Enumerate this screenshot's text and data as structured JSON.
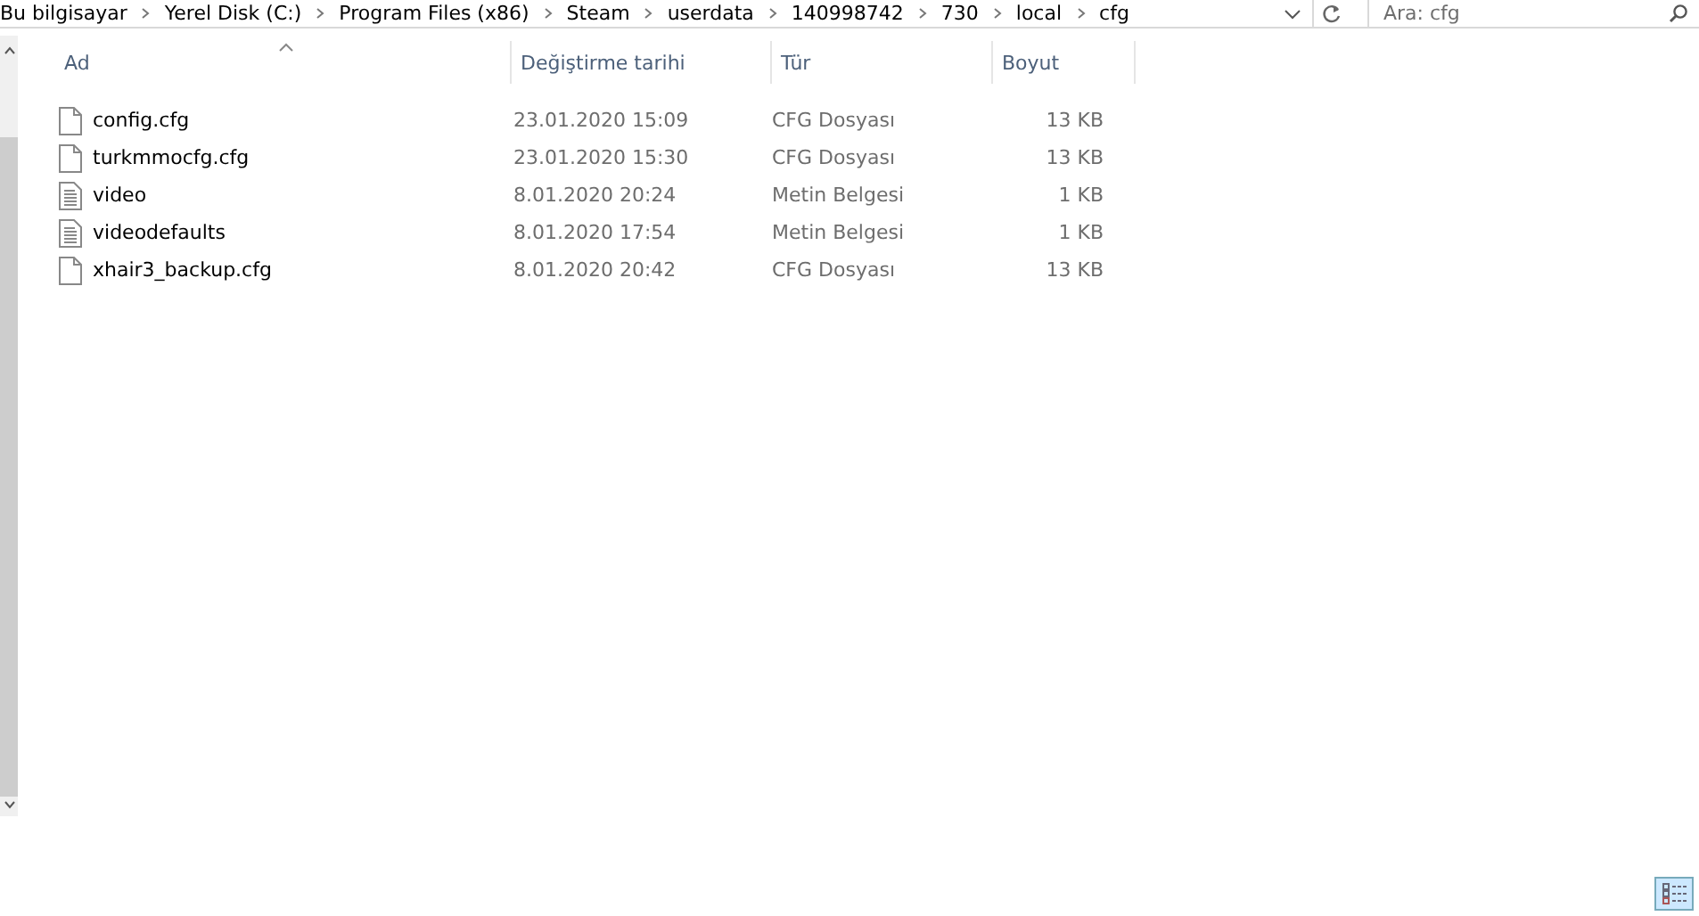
{
  "breadcrumb": [
    "Bu bilgisayar",
    "Yerel Disk (C:)",
    "Program Files (x86)",
    "Steam",
    "userdata",
    "140998742",
    "730",
    "local",
    "cfg"
  ],
  "search": {
    "placeholder": "Ara: cfg"
  },
  "columns": [
    "Ad",
    "Değiştirme tarihi",
    "Tür",
    "Boyut"
  ],
  "files": [
    {
      "kind": "blank",
      "name": "config.cfg",
      "modified": "23.01.2020 15:09",
      "type": "CFG Dosyası",
      "size": "13 KB"
    },
    {
      "kind": "blank",
      "name": "turkmmocfg.cfg",
      "modified": "23.01.2020 15:30",
      "type": "CFG Dosyası",
      "size": "13 KB"
    },
    {
      "kind": "text",
      "name": "video",
      "modified": "8.01.2020 20:24",
      "type": "Metin Belgesi",
      "size": "1 KB"
    },
    {
      "kind": "text",
      "name": "videodefaults",
      "modified": "8.01.2020 17:54",
      "type": "Metin Belgesi",
      "size": "1 KB"
    },
    {
      "kind": "blank",
      "name": "xhair3_backup.cfg",
      "modified": "8.01.2020 20:42",
      "type": "CFG Dosyası",
      "size": "13 KB"
    }
  ]
}
